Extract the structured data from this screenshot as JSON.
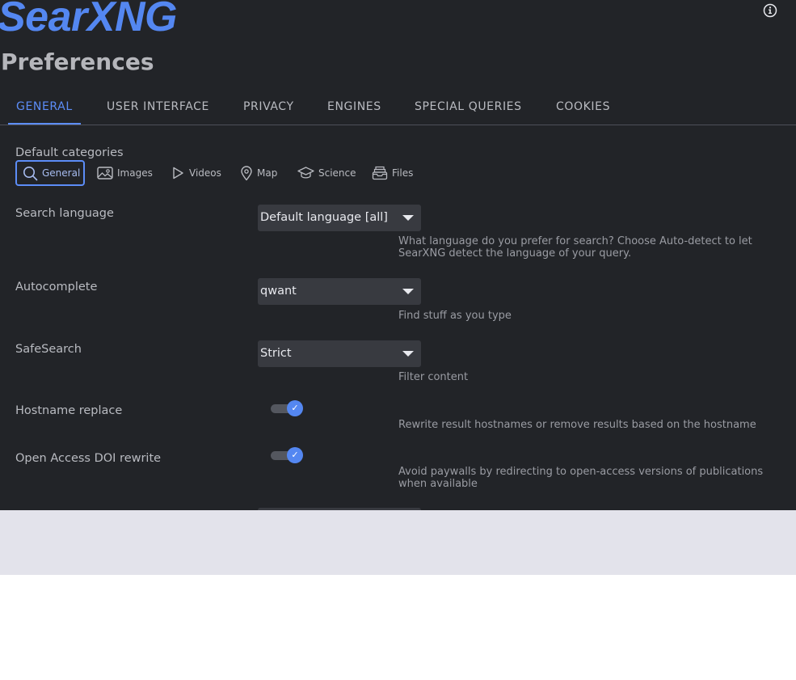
{
  "app": {
    "logo": "SearXNG",
    "info_icon": "info-icon"
  },
  "page": {
    "title": "Preferences"
  },
  "tabs": [
    {
      "label": "GENERAL",
      "active": true
    },
    {
      "label": "USER INTERFACE",
      "active": false
    },
    {
      "label": "PRIVACY",
      "active": false
    },
    {
      "label": "ENGINES",
      "active": false
    },
    {
      "label": "SPECIAL QUERIES",
      "active": false
    },
    {
      "label": "COOKIES",
      "active": false
    }
  ],
  "categories": {
    "label": "Default categories",
    "items": [
      {
        "label": "General",
        "icon": "search-icon",
        "selected": true
      },
      {
        "label": "Images",
        "icon": "image-icon",
        "selected": false
      },
      {
        "label": "Videos",
        "icon": "play-icon",
        "selected": false
      },
      {
        "label": "Map",
        "icon": "map-pin-icon",
        "selected": false
      },
      {
        "label": "Science",
        "icon": "graduation-cap-icon",
        "selected": false
      },
      {
        "label": "Files",
        "icon": "file-tray-icon",
        "selected": false
      }
    ]
  },
  "settings": {
    "search_language": {
      "label": "Search language",
      "value": "Default language [all]",
      "description": "What language do you prefer for search? Choose Auto-detect to let SearXNG detect the language of your query."
    },
    "autocomplete": {
      "label": "Autocomplete",
      "value": "qwant",
      "description": "Find stuff as you type"
    },
    "safesearch": {
      "label": "SafeSearch",
      "value": "Strict",
      "description": "Filter content"
    },
    "hostname_replace": {
      "label": "Hostname replace",
      "enabled": true,
      "description": "Rewrite result hostnames or remove results based on the hostname"
    },
    "oa_doi_rewrite": {
      "label": "Open Access DOI rewrite",
      "enabled": true,
      "description": "Avoid paywalls by redirecting to open-access versions of publications when available"
    }
  },
  "colors": {
    "accent": "#5c8df7",
    "background": "#222428",
    "text": "#b9bbc1",
    "select_bg": "#383a40"
  }
}
